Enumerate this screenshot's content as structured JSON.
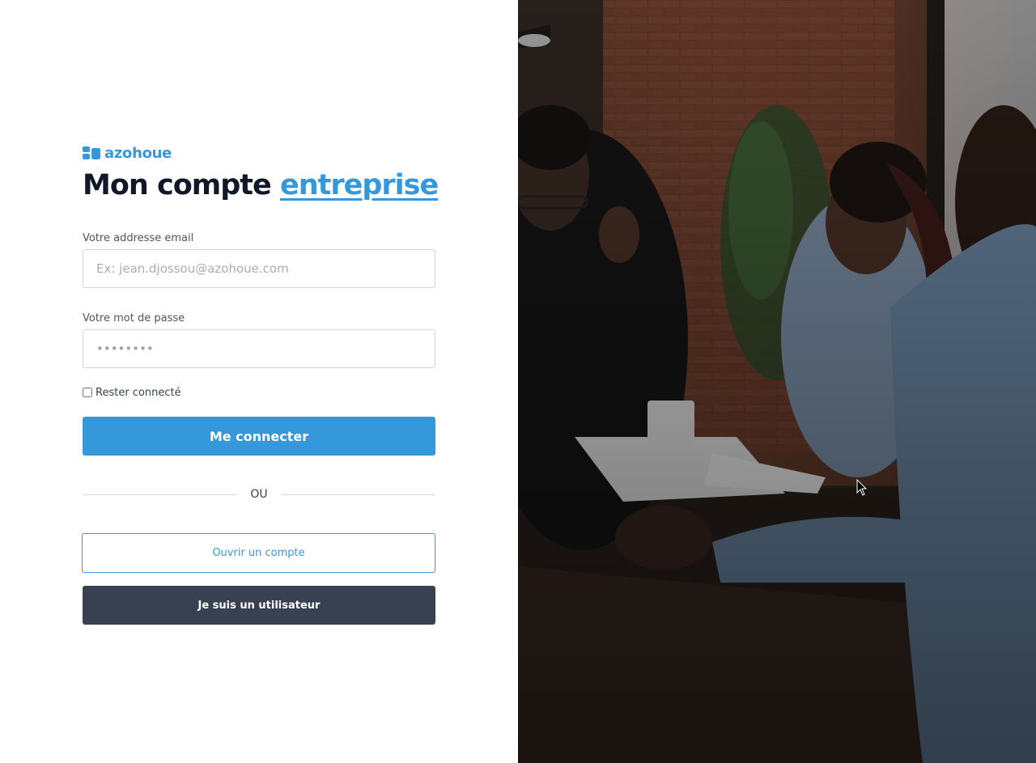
{
  "brand": {
    "name": "azohoue",
    "logo_icon": "azohoue-logo-icon",
    "color": "#3498db"
  },
  "title": {
    "main": "Mon compte",
    "accent": "entreprise"
  },
  "form": {
    "email_label": "Votre addresse email",
    "email_placeholder": "Ex: jean.djossou@azohoue.com",
    "email_value": "",
    "password_label": "Votre mot de passe",
    "password_value": "••••••••",
    "remember_label": "Rester connecté",
    "remember_checked": false,
    "submit_label": "Me connecter"
  },
  "divider": {
    "text": "OU"
  },
  "actions": {
    "open_account_label": "Ouvrir un compte",
    "user_login_label": "Je suis un utilisateur"
  },
  "colors": {
    "primary": "#3498db",
    "dark": "#374151",
    "text": "#111827"
  }
}
